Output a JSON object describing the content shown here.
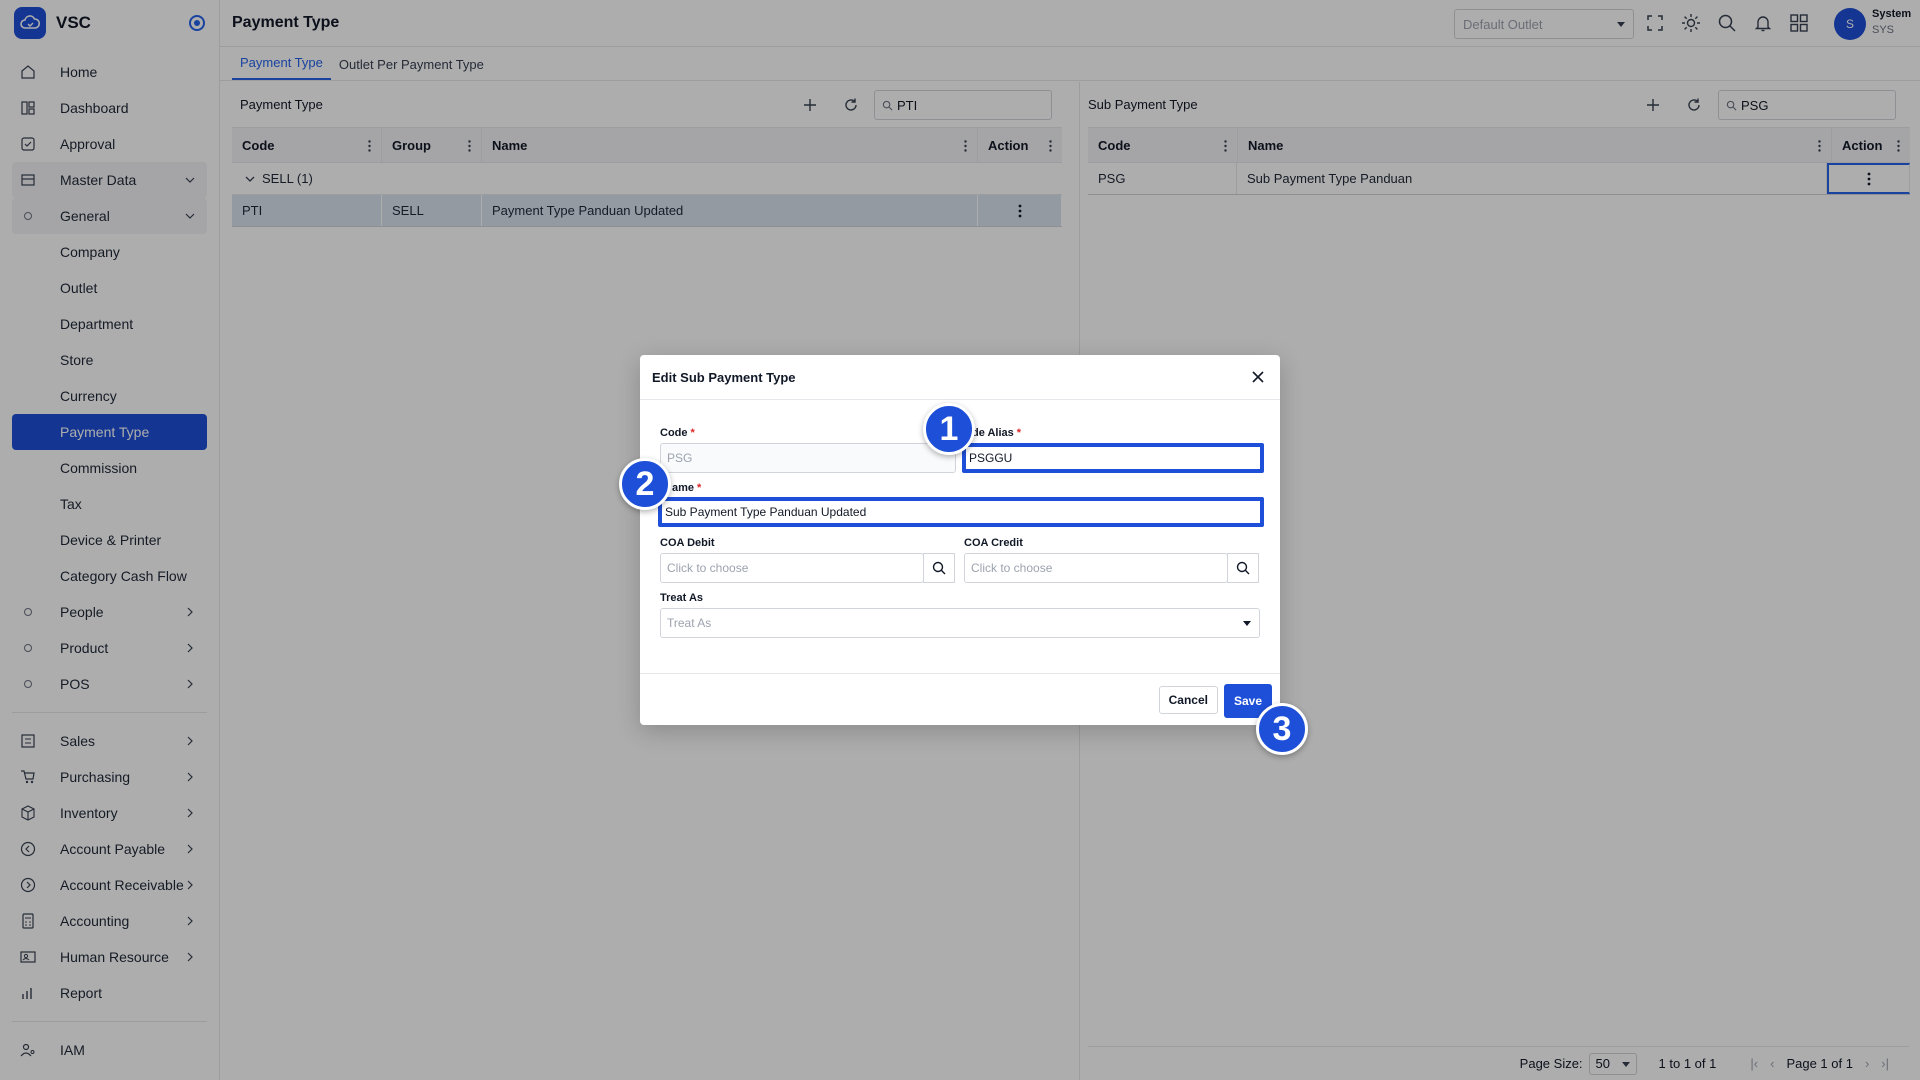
{
  "app": {
    "name": "VSC"
  },
  "sidebar": {
    "items": [
      {
        "label": "Home",
        "icon": "home-icon"
      },
      {
        "label": "Dashboard",
        "icon": "dashboard-icon"
      },
      {
        "label": "Approval",
        "icon": "approval-icon"
      },
      {
        "label": "Master Data",
        "icon": "master-data-icon"
      },
      {
        "label": "General",
        "icon": "circle-icon"
      },
      {
        "label": "Company"
      },
      {
        "label": "Outlet"
      },
      {
        "label": "Department"
      },
      {
        "label": "Store"
      },
      {
        "label": "Currency"
      },
      {
        "label": "Payment Type"
      },
      {
        "label": "Commission"
      },
      {
        "label": "Tax"
      },
      {
        "label": "Device & Printer"
      },
      {
        "label": "Category Cash Flow"
      },
      {
        "label": "People"
      },
      {
        "label": "Product"
      },
      {
        "label": "POS"
      },
      {
        "label": "Sales",
        "icon": "sales-icon"
      },
      {
        "label": "Purchasing",
        "icon": "cart-icon"
      },
      {
        "label": "Inventory",
        "icon": "box-icon"
      },
      {
        "label": "Account Payable",
        "icon": "arrow-left-circle-icon"
      },
      {
        "label": "Account Receivable",
        "icon": "arrow-right-circle-icon"
      },
      {
        "label": "Accounting",
        "icon": "calculator-icon"
      },
      {
        "label": "Human Resource",
        "icon": "person-card-icon"
      },
      {
        "label": "Report",
        "icon": "chart-icon"
      },
      {
        "label": "IAM",
        "icon": "user-key-icon"
      }
    ]
  },
  "header": {
    "title": "Payment Type",
    "outlet_placeholder": "Default Outlet",
    "user_name": "System",
    "user_code": "SYS",
    "avatar_initial": "S"
  },
  "tabs": [
    {
      "label": "Payment Type",
      "active": true
    },
    {
      "label": "Outlet Per Payment Type",
      "active": false
    }
  ],
  "left_panel": {
    "title": "Payment Type",
    "search_value": "PTI",
    "columns": [
      "Code",
      "Group",
      "Name",
      "Action"
    ],
    "group_label": "SELL (1)",
    "rows": [
      {
        "code": "PTI",
        "group": "SELL",
        "name": "Payment Type Panduan Updated"
      }
    ]
  },
  "right_panel": {
    "title": "Sub Payment Type",
    "search_value": "PSG",
    "columns": [
      "Code",
      "Name",
      "Action"
    ],
    "rows": [
      {
        "code": "PSG",
        "name": "Sub Payment Type Panduan"
      }
    ],
    "pager": {
      "page_size_label": "Page Size:",
      "page_size": "50",
      "range": "1 to 1 of 1",
      "page_text": "Page 1 of 1"
    }
  },
  "modal": {
    "title": "Edit Sub Payment Type",
    "code_label": "Code",
    "code_value": "PSG",
    "alias_label": "de Alias",
    "alias_value": "PSGGU",
    "name_label": "ame",
    "name_value": "Sub Payment Type Panduan Updated",
    "coa_debit_label": "COA Debit",
    "coa_debit_placeholder": "Click to choose",
    "coa_credit_label": "COA Credit",
    "coa_credit_placeholder": "Click to choose",
    "treat_as_label": "Treat As",
    "treat_as_placeholder": "Treat As",
    "cancel_label": "Cancel",
    "save_label": "Save",
    "required_mark": "*"
  },
  "markers": [
    "1",
    "2",
    "3"
  ],
  "colors": {
    "accent": "#1e4fd8",
    "active_tab": "#2563eb",
    "required": "#dc2626"
  }
}
